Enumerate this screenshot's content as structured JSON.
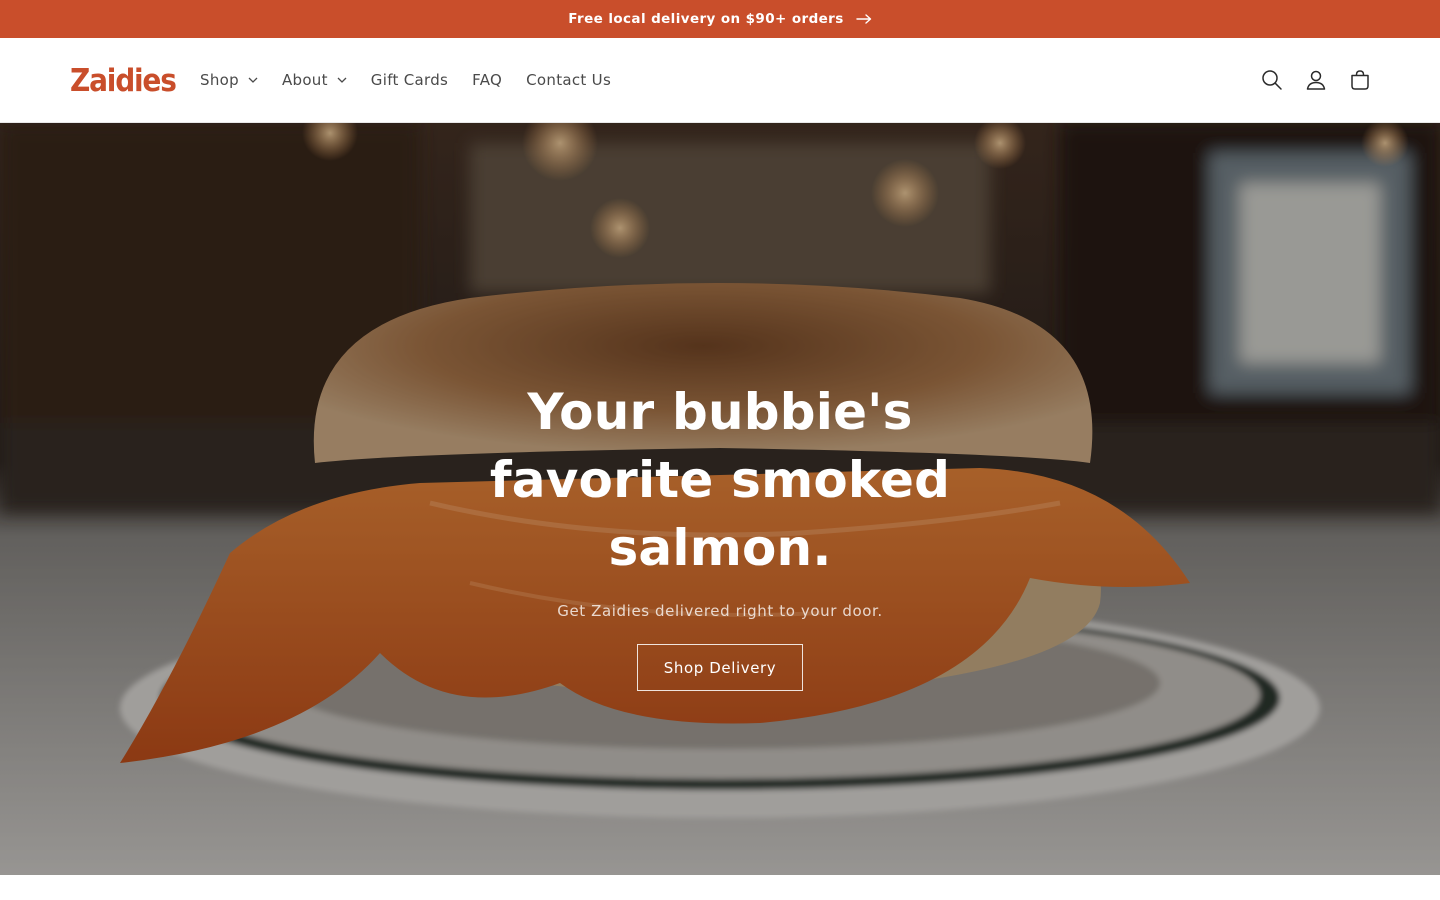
{
  "announcement": {
    "text": "Free local delivery on $90+ orders",
    "arrow_icon": "arrow-right-icon"
  },
  "header": {
    "logo": "Zaidies",
    "nav": [
      {
        "label": "Shop",
        "has_dropdown": true
      },
      {
        "label": "About",
        "has_dropdown": true
      },
      {
        "label": "Gift Cards",
        "has_dropdown": false
      },
      {
        "label": "FAQ",
        "has_dropdown": false
      },
      {
        "label": "Contact Us",
        "has_dropdown": false
      }
    ],
    "icons": [
      "search-icon",
      "account-icon",
      "cart-icon"
    ]
  },
  "hero": {
    "title": "Your bubbie's favorite smoked salmon.",
    "subtitle": "Get Zaidies delivered right to your door.",
    "button": "Shop Delivery"
  },
  "colors": {
    "brand": "#c94e2b",
    "header_bg": "#ffffff",
    "nav_text": "#4a4a4a"
  }
}
